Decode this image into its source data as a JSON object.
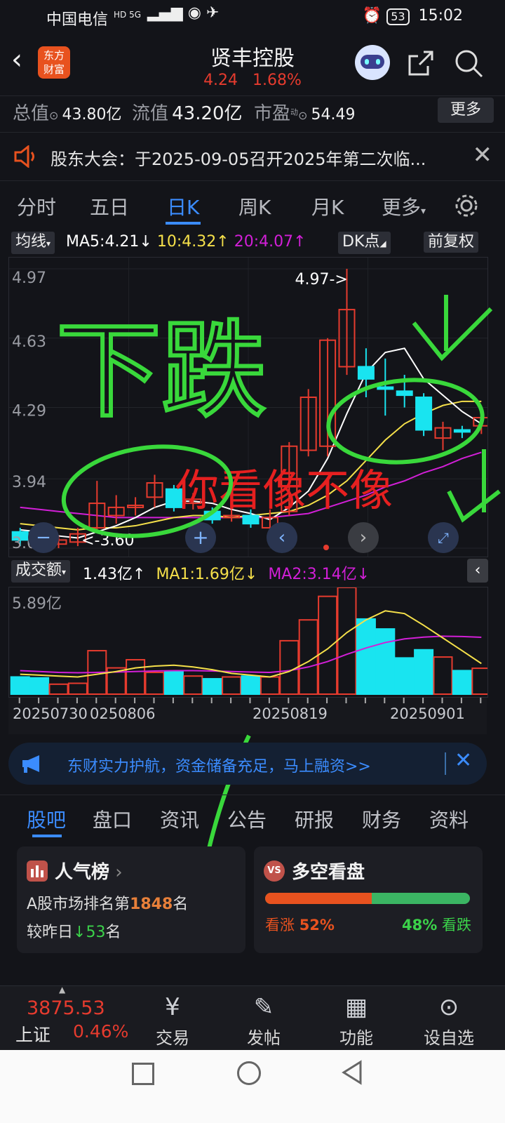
{
  "status": {
    "carrier": "中国电信",
    "indicators": "HD 5G",
    "battery": "53",
    "time": "15:02"
  },
  "header": {
    "logo_line1": "东方",
    "logo_line2": "财富",
    "title": "贤丰控股",
    "price": "4.24",
    "change": "1.68%"
  },
  "metrics": {
    "total_label": "总值",
    "total_value": "43.80亿",
    "float_label": "流值",
    "float_value": "43.20亿",
    "pe_label": "市盈",
    "pe_sup": "动",
    "pe_value": "54.49",
    "more_button": "更多"
  },
  "notice": {
    "text": "股东大会：于2025-09-05召开2025年第二次临..."
  },
  "chart_tabs": [
    "分时",
    "五日",
    "日K",
    "周K",
    "月K",
    "更多"
  ],
  "ma_bar": {
    "selector": "均线",
    "ma5": "MA5:4.21",
    "ma10": "10:4.32",
    "ma20": "20:4.07",
    "dk": "DK点",
    "fq": "前复权"
  },
  "vol_bar": {
    "selector": "成交额",
    "amount": "1.43亿",
    "ma1": "MA1:1.69亿",
    "ma2": "MA2:3.14亿"
  },
  "annotations": {
    "text_down": "下跌",
    "text_question": "你看像不像"
  },
  "colors": {
    "up": "#e63b2e",
    "down": "#19e4f0",
    "ma5": "#ffffff",
    "ma10": "#f5e04a",
    "ma20": "#d21fd7",
    "accent": "#3b8cff",
    "green": "#3bd24a"
  },
  "chart_data": {
    "type": "candlestick",
    "y_ticks": [
      "4.97",
      "4.63",
      "4.29",
      "3.94",
      "3.60"
    ],
    "ylim": [
      3.6,
      4.97
    ],
    "max_label": "4.97->",
    "min_label": "<-3.60",
    "vol_max_label": "5.89亿",
    "vol_ylim": [
      0,
      5.89
    ],
    "x_labels": [
      "20250730",
      "0250806",
      "20250819",
      "20250901"
    ],
    "candles": [
      {
        "o": 3.68,
        "c": 3.64,
        "h": 3.7,
        "l": 3.61,
        "v": 0.95
      },
      {
        "o": 3.66,
        "c": 3.62,
        "h": 3.68,
        "l": 3.6,
        "v": 0.9
      },
      {
        "o": 3.62,
        "c": 3.64,
        "h": 3.66,
        "l": 3.6,
        "v": 0.55
      },
      {
        "o": 3.63,
        "c": 3.67,
        "h": 3.7,
        "l": 3.61,
        "v": 0.6
      },
      {
        "o": 3.7,
        "c": 3.82,
        "h": 3.93,
        "l": 3.68,
        "v": 2.4
      },
      {
        "o": 3.76,
        "c": 3.8,
        "h": 3.86,
        "l": 3.72,
        "v": 1.45
      },
      {
        "o": 3.8,
        "c": 3.81,
        "h": 3.85,
        "l": 3.76,
        "v": 1.9
      },
      {
        "o": 3.85,
        "c": 3.92,
        "h": 3.96,
        "l": 3.8,
        "v": 1.2
      },
      {
        "o": 3.89,
        "c": 3.8,
        "h": 3.91,
        "l": 3.78,
        "v": 1.25
      },
      {
        "o": 3.82,
        "c": 3.84,
        "h": 3.87,
        "l": 3.79,
        "v": 1.0
      },
      {
        "o": 3.78,
        "c": 3.74,
        "h": 3.8,
        "l": 3.72,
        "v": 0.85
      },
      {
        "o": 3.75,
        "c": 3.76,
        "h": 3.79,
        "l": 3.73,
        "v": 0.95
      },
      {
        "o": 3.76,
        "c": 3.72,
        "h": 3.79,
        "l": 3.7,
        "v": 1.0
      },
      {
        "o": 3.7,
        "c": 3.75,
        "h": 3.79,
        "l": 3.68,
        "v": 0.95
      },
      {
        "o": 3.78,
        "c": 4.1,
        "h": 4.12,
        "l": 3.76,
        "v": 2.95
      },
      {
        "o": 4.08,
        "c": 4.34,
        "h": 4.38,
        "l": 4.05,
        "v": 4.1
      },
      {
        "o": 4.1,
        "c": 4.62,
        "h": 4.63,
        "l": 4.05,
        "v": 5.4
      },
      {
        "o": 4.49,
        "c": 4.77,
        "h": 4.97,
        "l": 4.45,
        "v": 5.89
      },
      {
        "o": 4.49,
        "c": 4.43,
        "h": 4.58,
        "l": 4.34,
        "v": 4.15
      },
      {
        "o": 4.39,
        "c": 4.38,
        "h": 4.53,
        "l": 4.25,
        "v": 3.6
      },
      {
        "o": 4.37,
        "c": 4.35,
        "h": 4.45,
        "l": 4.29,
        "v": 2.0
      },
      {
        "o": 4.34,
        "c": 4.18,
        "h": 4.36,
        "l": 4.15,
        "v": 2.45
      },
      {
        "o": 4.14,
        "c": 4.19,
        "h": 4.22,
        "l": 4.08,
        "v": 2.05
      },
      {
        "o": 4.18,
        "c": 4.17,
        "h": 4.2,
        "l": 4.14,
        "v": 1.3
      },
      {
        "o": 4.2,
        "c": 4.24,
        "h": 4.28,
        "l": 4.16,
        "v": 1.43
      }
    ],
    "ma5": [
      3.69,
      3.68,
      3.66,
      3.65,
      3.68,
      3.71,
      3.75,
      3.8,
      3.83,
      3.83,
      3.82,
      3.79,
      3.77,
      3.74,
      3.8,
      3.88,
      4.04,
      4.26,
      4.46,
      4.56,
      4.58,
      4.43,
      4.35,
      4.27,
      4.21
    ],
    "ma10": [
      3.72,
      3.71,
      3.7,
      3.69,
      3.7,
      3.7,
      3.71,
      3.73,
      3.75,
      3.76,
      3.76,
      3.75,
      3.76,
      3.77,
      3.78,
      3.81,
      3.86,
      3.93,
      4.03,
      4.13,
      4.21,
      4.26,
      4.3,
      4.32,
      4.32
    ],
    "ma20": [
      3.8,
      3.79,
      3.78,
      3.77,
      3.76,
      3.75,
      3.75,
      3.75,
      3.75,
      3.75,
      3.75,
      3.75,
      3.75,
      3.75,
      3.76,
      3.77,
      3.8,
      3.83,
      3.86,
      3.9,
      3.93,
      3.97,
      4.0,
      4.04,
      4.07
    ],
    "vol_ma1": [
      1.1,
      1.05,
      1.0,
      0.95,
      1.1,
      1.25,
      1.45,
      1.55,
      1.6,
      1.5,
      1.35,
      1.15,
      1.05,
      0.95,
      1.25,
      1.8,
      2.5,
      3.4,
      4.1,
      4.6,
      4.45,
      3.8,
      3.1,
      2.4,
      1.69
    ],
    "vol_ma2": [
      1.3,
      1.25,
      1.2,
      1.18,
      1.2,
      1.22,
      1.25,
      1.28,
      1.3,
      1.3,
      1.28,
      1.25,
      1.22,
      1.2,
      1.3,
      1.5,
      1.8,
      2.2,
      2.55,
      2.85,
      3.05,
      3.15,
      3.2,
      3.18,
      3.14
    ]
  },
  "promo": {
    "text": "东财实力护航，资金储备充足，马上融资>>"
  },
  "section_tabs": [
    "股吧",
    "盘口",
    "资讯",
    "公告",
    "研报",
    "财务",
    "资料"
  ],
  "popularity": {
    "title": "人气榜",
    "rank_prefix": "A股市场排名第",
    "rank": "1848",
    "rank_suffix": "名",
    "compare_prefix": "较昨日",
    "compare_value": "53",
    "compare_suffix": "名"
  },
  "sentiment": {
    "title": "多空看盘",
    "bull_label": "看涨",
    "bull_pct": "52%",
    "bear_pct": "48%",
    "bear_label": "看跌",
    "bull_fraction": 0.52
  },
  "index": {
    "value": "3875.53",
    "name": "上证",
    "change": "0.46%"
  },
  "bottom_nav": [
    "交易",
    "发帖",
    "功能",
    "设自选"
  ]
}
